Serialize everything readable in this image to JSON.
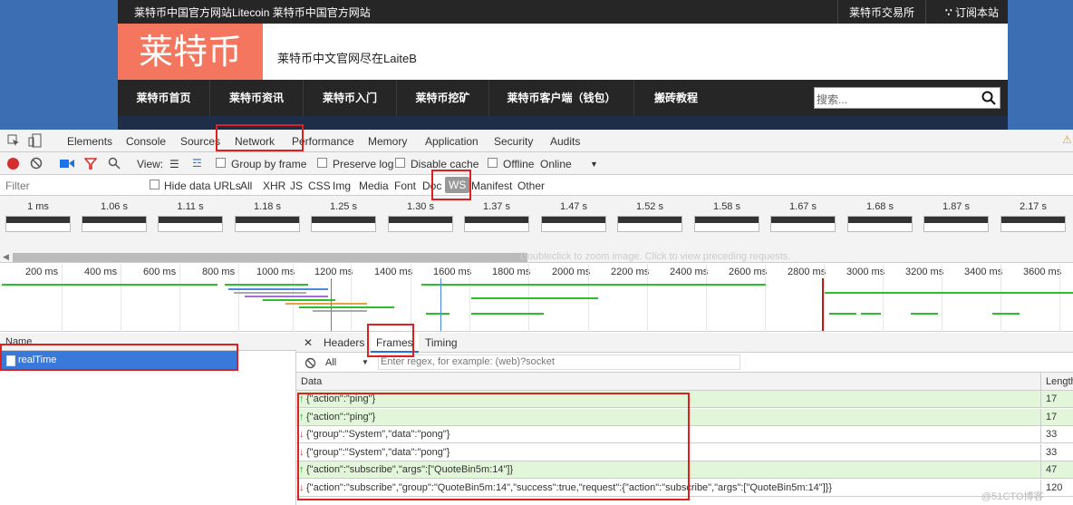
{
  "site": {
    "topbar_title": "莱特币中国官方网站Litecoin 莱特币中国官方网站",
    "exchange_link": "莱特币交易所",
    "subscribe_link": "订阅本站",
    "logo_text": "莱特币",
    "slogan": "莱特币中文官网尽在LaiteB",
    "nav": [
      "莱特币首页",
      "莱特币资讯",
      "莱特币入门",
      "莱特币挖矿",
      "莱特币客户端（钱包）",
      "搬砖教程"
    ],
    "search_placeholder": "搜索..."
  },
  "devtools": {
    "tabs": [
      "Elements",
      "Console",
      "Sources",
      "Network",
      "Performance",
      "Memory",
      "Application",
      "Security",
      "Audits"
    ],
    "toolbar": {
      "view_label": "View:",
      "group_by_frame": "Group by frame",
      "preserve_log": "Preserve log",
      "disable_cache": "Disable cache",
      "offline": "Offline",
      "throttle": "Online"
    },
    "filter": {
      "placeholder": "Filter",
      "hide_data_urls": "Hide data URLs",
      "types": [
        "All",
        "XHR",
        "JS",
        "CSS",
        "Img",
        "Media",
        "Font",
        "Doc",
        "WS",
        "Manifest",
        "Other"
      ],
      "active_type": "WS"
    },
    "screenshots": [
      "1 ms",
      "1.06 s",
      "1.11 s",
      "1.18 s",
      "1.25 s",
      "1.30 s",
      "1.37 s",
      "1.47 s",
      "1.52 s",
      "1.58 s",
      "1.67 s",
      "1.68 s",
      "1.87 s",
      "2.17 s"
    ],
    "scroll_hint": "Doubleclick to zoom image. Click to view preceding requests.",
    "timeline_ticks": [
      "200 ms",
      "400 ms",
      "600 ms",
      "800 ms",
      "1000 ms",
      "1200 ms",
      "1400 ms",
      "1600 ms",
      "1800 ms",
      "2000 ms",
      "2200 ms",
      "2400 ms",
      "2600 ms",
      "2800 ms",
      "3000 ms",
      "3200 ms",
      "3400 ms",
      "3600 ms"
    ],
    "name_header": "Name",
    "request_name": "realTime",
    "detail_tabs": [
      "Headers",
      "Frames",
      "Timing"
    ],
    "frames_filter": {
      "select": "All",
      "placeholder": "Enter regex, for example: (web)?socket"
    },
    "data_header": "Data",
    "length_header": "Length",
    "frames": [
      {
        "dir": "sent",
        "data": "{\"action\":\"ping\"}",
        "length": "17"
      },
      {
        "dir": "sent",
        "data": "{\"action\":\"ping\"}",
        "length": "17"
      },
      {
        "dir": "recv",
        "data": "{\"group\":\"System\",\"data\":\"pong\"}",
        "length": "33"
      },
      {
        "dir": "recv",
        "data": "{\"group\":\"System\",\"data\":\"pong\"}",
        "length": "33"
      },
      {
        "dir": "sent",
        "data": "{\"action\":\"subscribe\",\"args\":[\"QuoteBin5m:14\"]}",
        "length": "47"
      },
      {
        "dir": "recv",
        "data": "{\"action\":\"subscribe\",\"group\":\"QuoteBin5m:14\",\"success\":true,\"request\":{\"action\":\"subscribe\",\"args\":[\"QuoteBin5m:14\"]}}",
        "length": "120"
      }
    ],
    "watermark": "@51CTO博客"
  },
  "colors": {
    "logo_bg": "#f4765e",
    "selected_row": "#3879d9",
    "sent_row": "#e2f7da",
    "highlight": "#e02020"
  }
}
